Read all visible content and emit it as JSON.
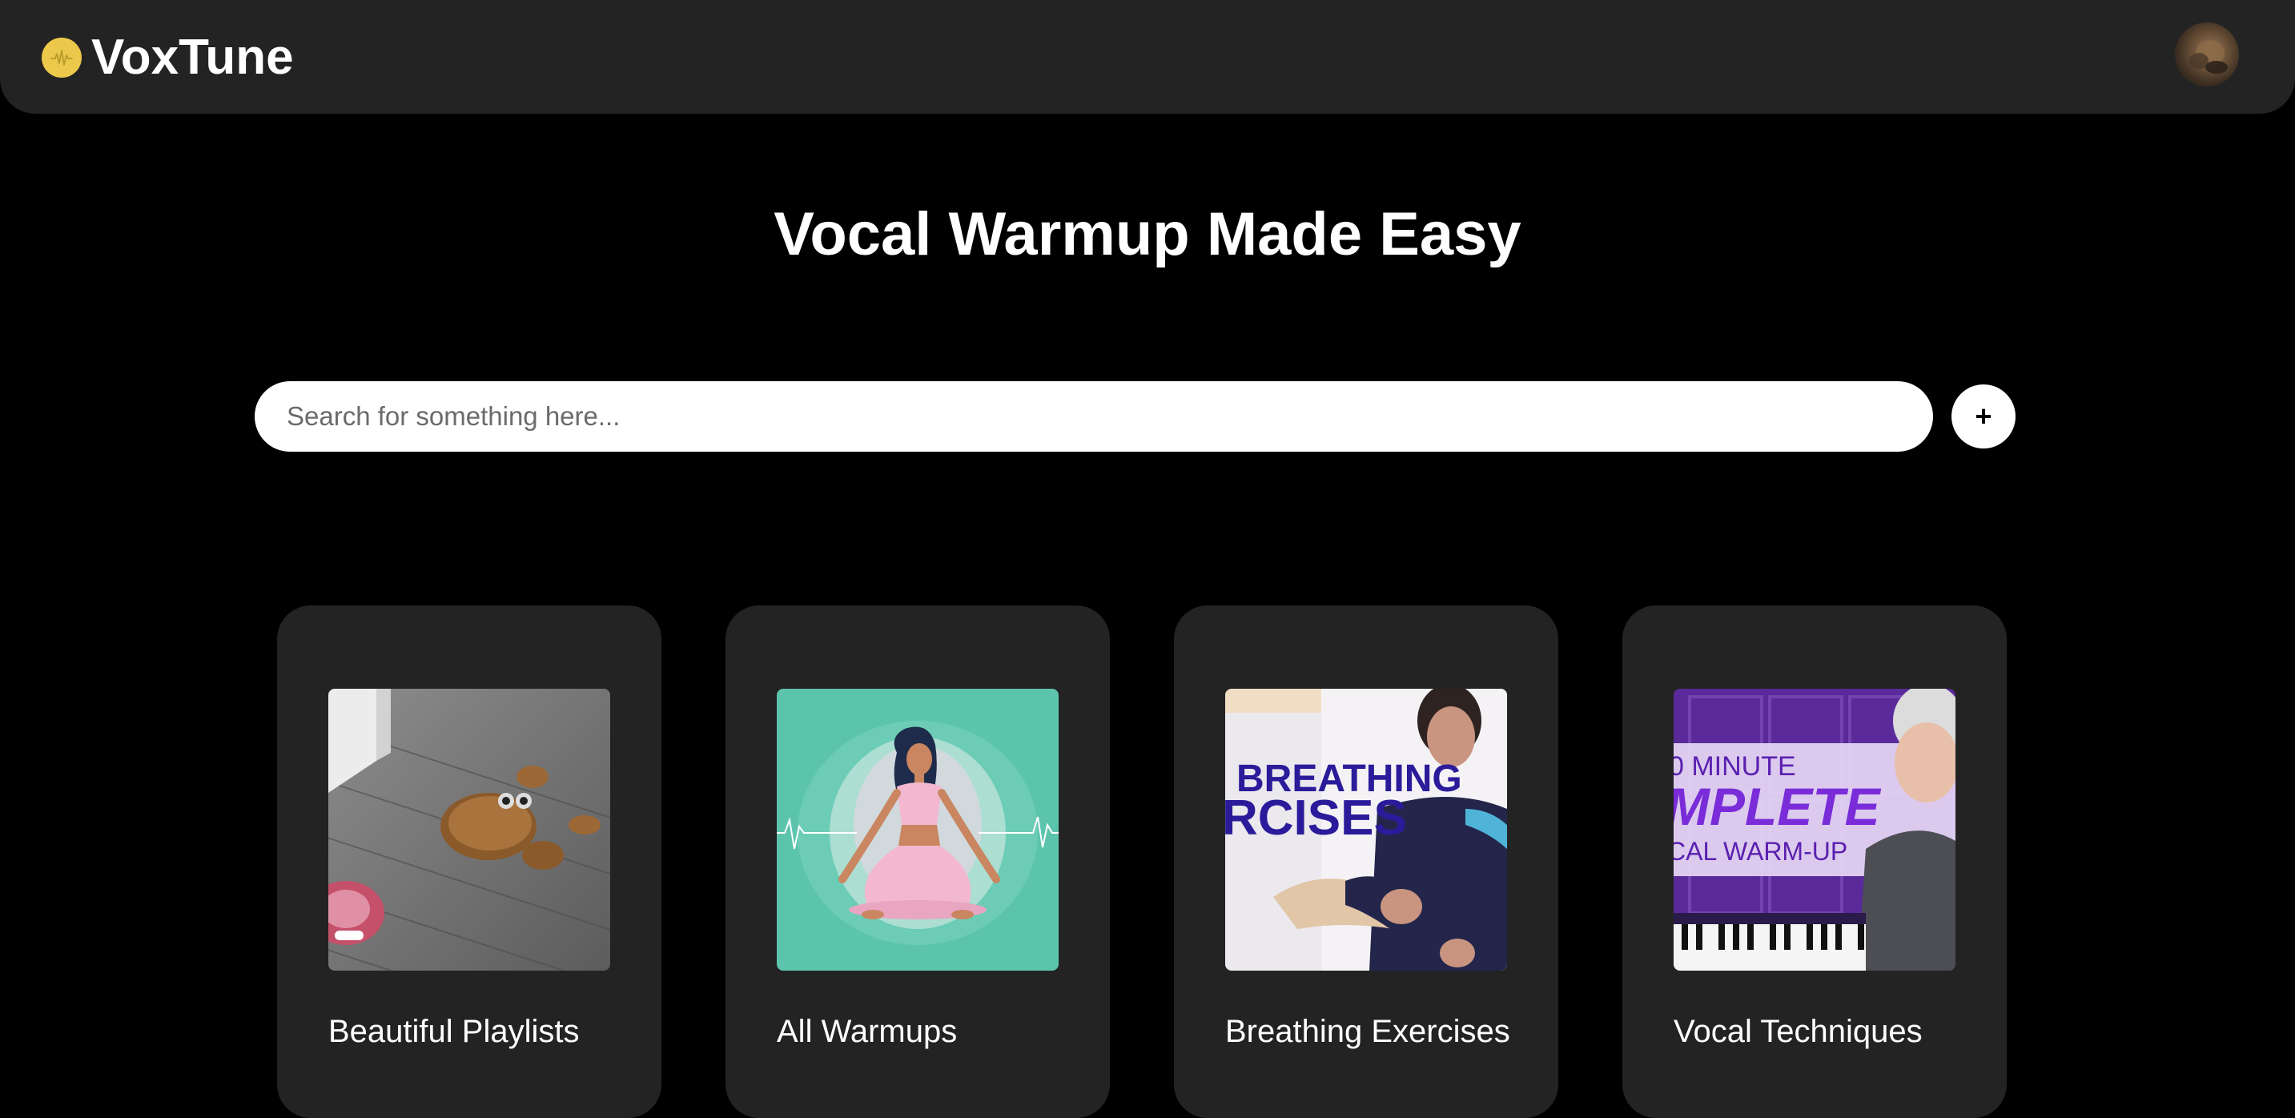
{
  "header": {
    "brand_name": "VoxTune",
    "logo_icon": "waveform-icon",
    "accent_color": "#ecc94b"
  },
  "hero": {
    "title": "Vocal Warmup Made Easy"
  },
  "search": {
    "placeholder": "Search for something here...",
    "value": "",
    "add_label": "+"
  },
  "cards": [
    {
      "label": "Beautiful Playlists",
      "image": "plush-dog-toy-on-wood-floor"
    },
    {
      "label": "All Warmups",
      "image": "meditating-woman-illustration"
    },
    {
      "label": "Breathing Exercises",
      "image": "breathing-exercises-video-thumbnail",
      "thumb_text": [
        "BREATHING",
        "RCISES"
      ]
    },
    {
      "label": "Vocal Techniques",
      "image": "vocal-warm-up-video-thumbnail",
      "thumb_text": [
        "0 MINUTE",
        "MPLETE",
        "CAL WARM-UP"
      ]
    }
  ]
}
